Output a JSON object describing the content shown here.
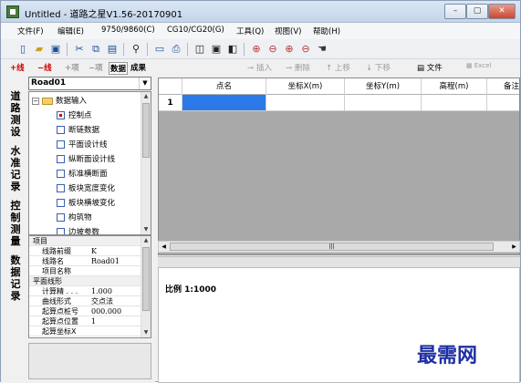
{
  "window": {
    "title": "Untitled - 道路之星V1.56-20170901",
    "min": "–",
    "max": "▢",
    "close": "✕"
  },
  "menu": [
    "文件(F)",
    "编辑(E)",
    "9750/9860(C)",
    "CG10/CG20(G)",
    "工具(Q)",
    "视图(V)",
    "帮助(H)"
  ],
  "left_toolbar": {
    "add_line": "+线",
    "del_line": "−线",
    "add_item": "+项",
    "del_item": "−项",
    "data": "数据",
    "result": "成果"
  },
  "road_select": "Road01",
  "vtabs": [
    "道路测设",
    "水准记录",
    "控制测量",
    "数据记录"
  ],
  "tree": {
    "root": "数据输入",
    "items": [
      "控制点",
      "断链数据",
      "平面设计线",
      "纵断面设计线",
      "标准横断面",
      "板块宽度变化",
      "板块横坡变化",
      "构筑物",
      "边坡参数"
    ]
  },
  "props": {
    "group1": "项目",
    "rows1": [
      [
        "线路前缀",
        "K"
      ],
      [
        "线路名",
        "Road01"
      ],
      [
        "项目名称",
        ""
      ]
    ],
    "group2": "平面线形",
    "rows2": [
      [
        "计算精 . . .",
        "1.000"
      ],
      [
        "曲线形式",
        "交点法"
      ],
      [
        "起算点桩号",
        "000.000"
      ],
      [
        "起算点位置",
        "1"
      ],
      [
        "起算坐标X",
        ""
      ]
    ]
  },
  "right_toolbar": {
    "insert": "插入",
    "delete": "删除",
    "up": "上移",
    "down": "下移",
    "file": "文件",
    "excel": "Excel"
  },
  "grid": {
    "headers": [
      "点名",
      "坐标X(m)",
      "坐标Y(m)",
      "高程(m)",
      "备注"
    ],
    "row_num": "1"
  },
  "scale": "比例 1:1000",
  "watermark": "最需网"
}
